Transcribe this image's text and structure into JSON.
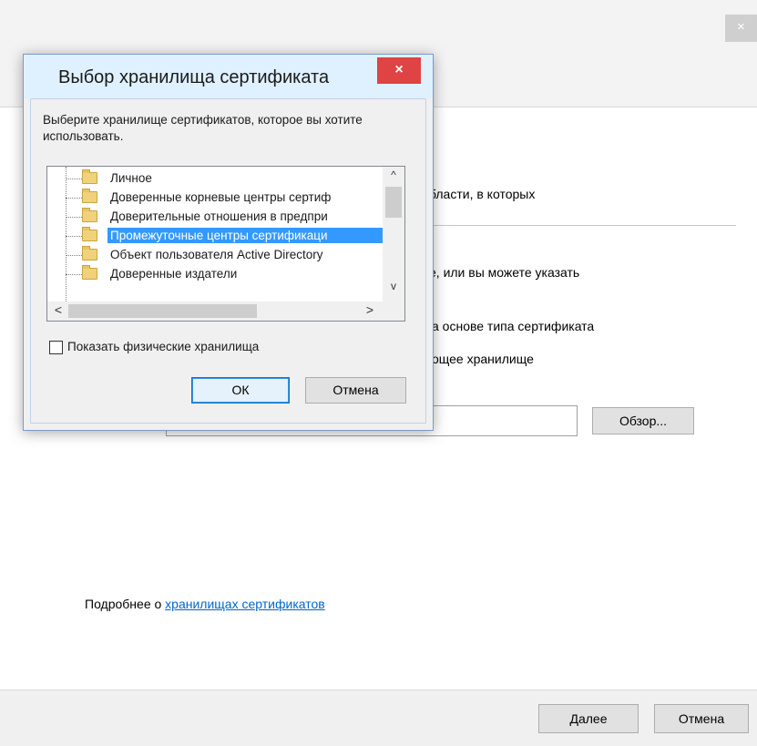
{
  "wizard": {
    "close_symbol": "×",
    "text_areas": "бласти, в которых",
    "text_or_specify": "е, или вы можете указать",
    "text_auto_select": "а основе типа сертификата",
    "text_place_store": "ощее хранилище",
    "browse_label": "Обзор...",
    "more_prefix": "Подробнее о ",
    "more_link": "хранилищах сертификатов",
    "next_label": "Далее",
    "cancel_label": "Отмена"
  },
  "dialog": {
    "title": "Выбор хранилища сертификата",
    "close_symbol": "×",
    "instruction": "Выберите хранилище сертификатов, которое вы хотите использовать.",
    "tree_items": [
      {
        "label": "Личное"
      },
      {
        "label": "Доверенные корневые центры сертиф"
      },
      {
        "label": "Доверительные отношения в предпри"
      },
      {
        "label": "Промежуточные центры сертификаци"
      },
      {
        "label": "Объект пользователя Active Directory"
      },
      {
        "label": "Доверенные издатели"
      }
    ],
    "selected_index": 3,
    "scroll_up": "^",
    "scroll_down": "v",
    "scroll_left": "<",
    "scroll_right": ">",
    "show_physical_label": "Показать физические хранилища",
    "show_physical_checked": false,
    "ok_label": "ОК",
    "cancel_label": "Отмена"
  },
  "colors": {
    "selection": "#3399ff",
    "dialog_titlebar": "#dff1ff",
    "close_button": "#e04343",
    "link": "#0066cc"
  }
}
